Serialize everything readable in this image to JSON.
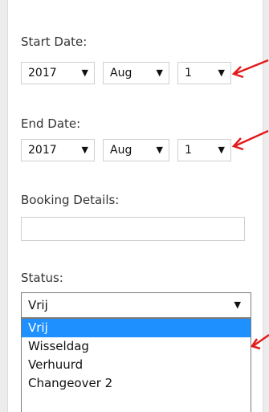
{
  "start_date": {
    "label": "Start Date:",
    "year": "2017",
    "month": "Aug",
    "day": "1"
  },
  "end_date": {
    "label": "End Date:",
    "year": "2017",
    "month": "Aug",
    "day": "1"
  },
  "booking_details": {
    "label": "Booking Details:",
    "value": ""
  },
  "status": {
    "label": "Status:",
    "selected": "Vrij",
    "options": [
      "Vrij",
      "Wisseldag",
      "Verhuurd",
      "Changeover 2"
    ]
  },
  "icons": {
    "caret": "▼",
    "annotation_color": "#e31b1b"
  }
}
